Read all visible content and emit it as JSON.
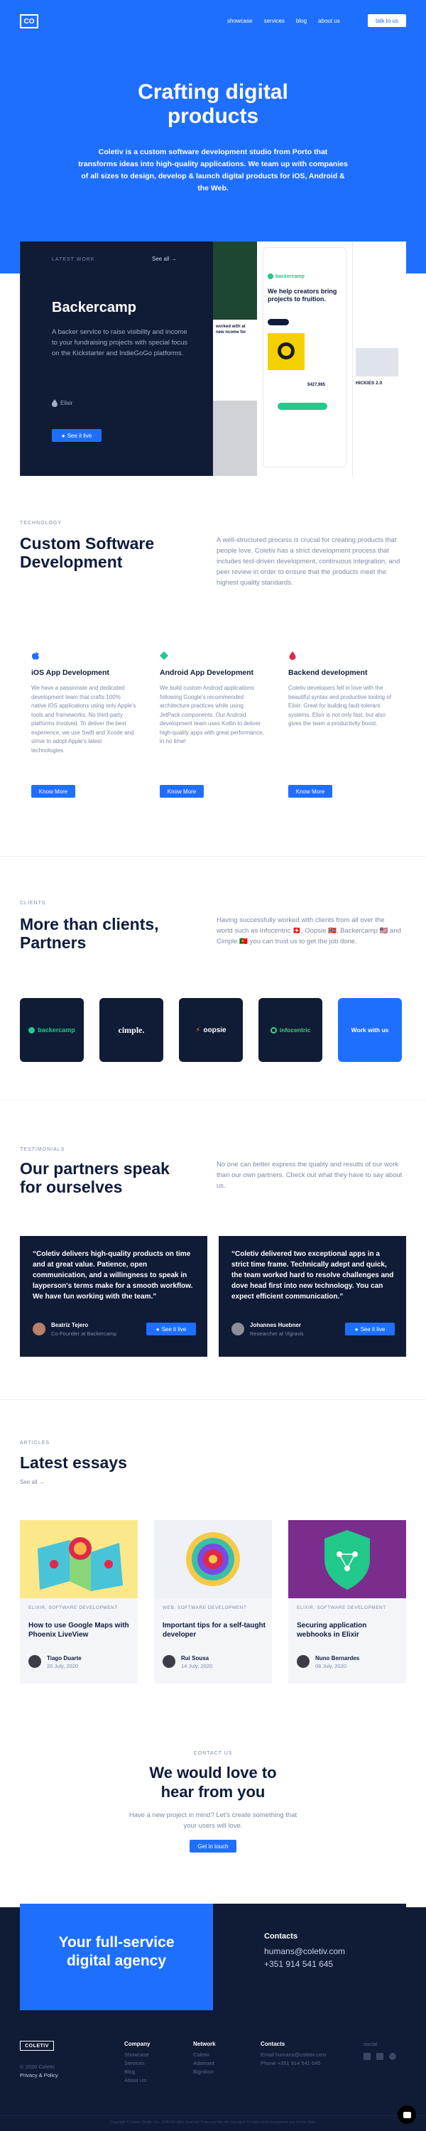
{
  "header": {
    "logo": "CO",
    "nav": [
      "showcase",
      "services",
      "blog",
      "about us"
    ],
    "cta": "talk to us"
  },
  "hero": {
    "title_line1": "Crafting digital",
    "title_line2": "products",
    "description": "Coletiv is a custom software development studio from Porto that transforms ideas into high-quality applications. We team up with companies of all sizes to design, develop & launch digital products for iOS, Android & the Web."
  },
  "latest_work": {
    "label": "LATEST WORK",
    "see_all": "See all",
    "title": "Backercamp",
    "description": "A backer service to raise visibility and income to your fundraising projects with special focus on the Kickstarter and IndieGoGo platforms.",
    "tech": "Elixir",
    "button": "See it live",
    "mockup": {
      "brand": "backercamp",
      "headline": "We help creators bring projects to fruition.",
      "product_name": "HICKIES 2.0",
      "price": "$427,985",
      "worked_with": "worked with at",
      "income_line": "new ncome for"
    }
  },
  "technology": {
    "label": "TECHNOLOGY",
    "title_line1": "Custom Software",
    "title_line2": "Development",
    "description": "A well-structured process is crucial for creating products that people love. Coletiv has a strict development process that includes test-driven development, continuous integration, and peer review in order to ensure that the products meet the highest quality standards.",
    "cards": [
      {
        "title": "iOS App Development",
        "description": "We have a passionate and dedicated development team that crafts 100% native iOS applications using only Apple's tools and frameworks. No third-party platforms involved. To deliver the best experience, we use Swift and Xcode and strive to adopt Apple's latest technologies.",
        "button": "Know More"
      },
      {
        "title": "Android App Development",
        "description": "We build custom Android applications following Google's recommended architecture practices while using JetPack components. Our Android development team uses Kotlin to deliver high-quality apps with great performance, in no time!",
        "button": "Know More"
      },
      {
        "title": "Backend development",
        "description": "Coletiv developers fell in love with the beautiful syntax and productive tooling of Elixir. Great for building fault-tolerant systems. Elixir is not only fast, but also gives the team a productivity boost.",
        "button": "Know More"
      }
    ]
  },
  "clients": {
    "label": "CLIENTS",
    "title_line1": "More than clients,",
    "title_line2": "Partners",
    "description": "Having successfully worked with clients from all over the world such as Infocentric 🇨🇭, Oopsie 🇳🇴, Backercamp 🇺🇸 and Cimple 🇵🇹 you can trust us to get the job done.",
    "logos": [
      "backercamp",
      "cimple.",
      "oopsie",
      "infocentric"
    ],
    "work_with_us": "Work with us",
    "colors": {
      "backercamp": "#21c98a",
      "oopsie": "#ff6b2b",
      "infocentric": "#44d17a"
    }
  },
  "testimonials": {
    "label": "TESTIMONIALS",
    "title_line1": "Our partners speak",
    "title_line2": "for ourselves",
    "description": "No one can better express the quality and results of our work than our own partners. Check out what they have to say about us.",
    "items": [
      {
        "quote": "“Coletiv delivers high-quality products on time and at great value. Patience, open communication, and a willingness to speak in layperson's terms make for a smooth workflow. We have fun working with the team.”",
        "name": "Beatriz Tejero",
        "role": "Co-Founder at Backercamp",
        "button": "See it live"
      },
      {
        "quote": "“Coletiv delivered two exceptional apps in a strict time frame. Technically adept and quick, the team worked hard to resolve challenges and dove head first into new technology. You can expect efficient communication.”",
        "name": "Johannes Huebner",
        "role": "Researcher at Vigravis",
        "button": "See it live"
      }
    ]
  },
  "articles": {
    "label": "ARTICLES",
    "title": "Latest essays",
    "see_all": "See all",
    "items": [
      {
        "category": "ELIXIR, SOFTWARE DEVELOPMENT",
        "title": "How to use Google Maps with Phoenix LiveView",
        "author": "Tiago Duarte",
        "date": "20 July, 2020"
      },
      {
        "category": "WEB, SOFTWARE DEVELOPMENT",
        "title": "Important tips for a self-taught developer",
        "author": "Rui Sousa",
        "date": "14 July, 2020"
      },
      {
        "category": "ELIXIR, SOFTWARE DEVELOPMENT",
        "title": "Securing application webhooks in Elixir",
        "author": "Nuno Bernardes",
        "date": "08 July, 2020"
      }
    ]
  },
  "contact": {
    "label": "CONTACT US",
    "title_line1": "We would love to",
    "title_line2": "hear from you",
    "description": "Have a new project in mind? Let's create something that your users will love.",
    "button": "Get in touch"
  },
  "cta": {
    "title_line1": "Your full-service",
    "title_line2": "digital agency",
    "contacts_title": "Contacts",
    "email": "humans@coletiv.com",
    "phone": "+351 914 541 645"
  },
  "footer": {
    "logo": "COLETIV",
    "copyright": "© 2020 Coletiv",
    "privacy": "Privacy & Policy",
    "company_title": "Company",
    "company_links": [
      "Showcase",
      "Services",
      "Blog",
      "About Us"
    ],
    "network_title": "Network",
    "network_links": [
      "Coletiv",
      "Adamant",
      "Bignition"
    ],
    "contacts_title": "Contacts",
    "contacts_links": [
      "Email humans@coletiv.com",
      "Phone +351 914 541 645"
    ],
    "social_title": "social",
    "bottom_text": "Copyright © Coletiv Studio Lda., 2020 All rights reserved. If you use this site you agree to make some transparent use of your data."
  }
}
